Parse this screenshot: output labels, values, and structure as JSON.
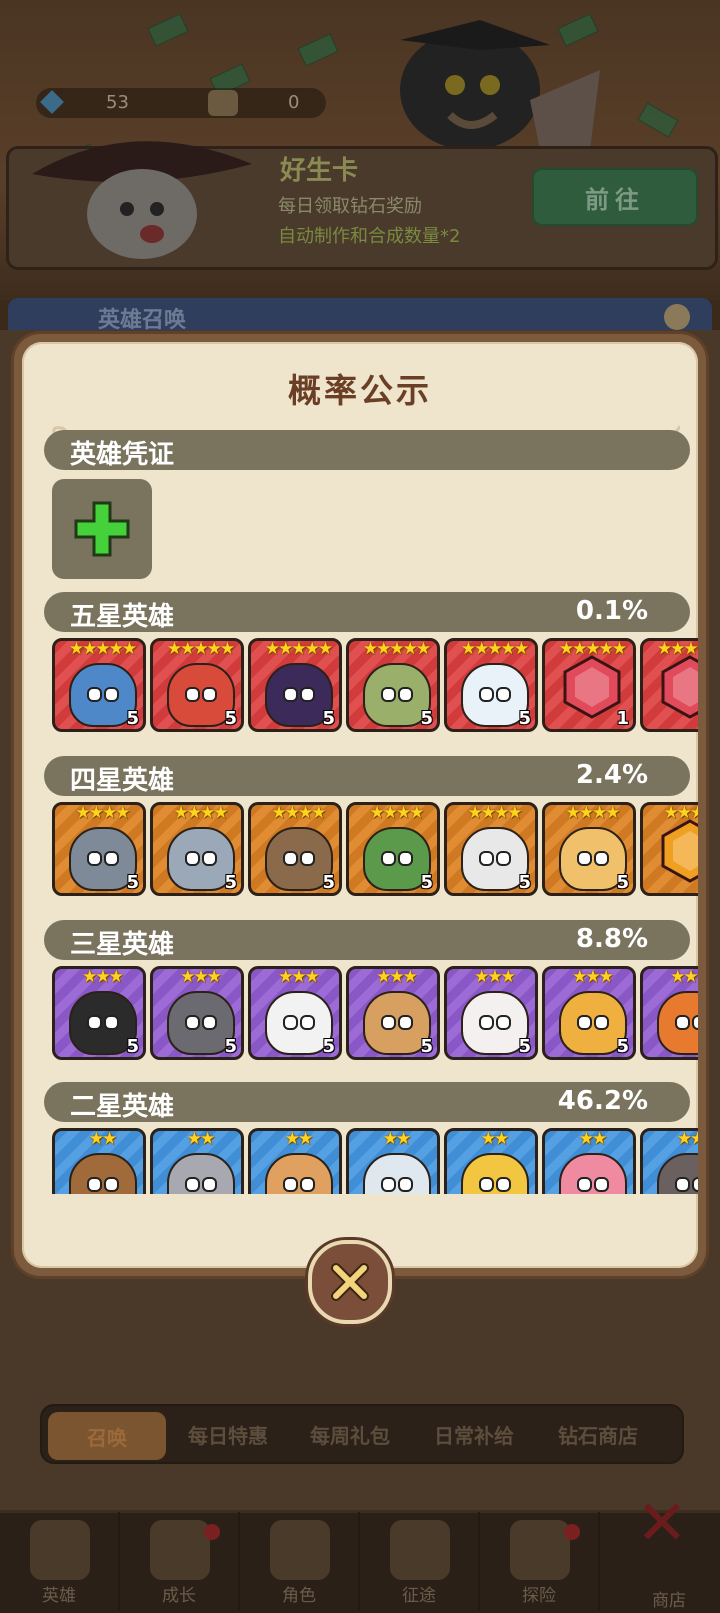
{
  "background": {
    "resources": {
      "gems": "53",
      "other": "0"
    },
    "banner": {
      "title": "好生卡",
      "line1": "每日领取钻石奖励",
      "line2": "自动制作和合成数量*2",
      "go_button": "前往"
    },
    "summon_strip_label": "英雄召唤",
    "tabs": [
      "召唤",
      "每日特惠",
      "每周礼包",
      "日常补给",
      "钻石商店"
    ],
    "active_tab": "召唤",
    "nav": [
      "英雄",
      "成长",
      "角色",
      "征途",
      "探险"
    ],
    "nav_shop_label": "商店"
  },
  "modal": {
    "title": "概率公示",
    "voucher_section": "英雄凭证",
    "sections": [
      {
        "label": "五星英雄",
        "percent": "0.1%",
        "rarity": "r5",
        "stars": "★★★★★",
        "cards": [
          {
            "icon": "shark-pirate-icon",
            "count": "5",
            "color": "#4e88c8"
          },
          {
            "icon": "red-warrior-icon",
            "count": "5",
            "color": "#d84a3a"
          },
          {
            "icon": "dark-reaper-icon",
            "count": "5",
            "color": "#3b2a5a"
          },
          {
            "icon": "crocodile-king-icon",
            "count": "5",
            "color": "#9ab06a"
          },
          {
            "icon": "polar-bear-icon",
            "count": "5",
            "color": "#e8f2f8"
          },
          {
            "icon": "red-hexagon-gem-icon",
            "count": "1",
            "color": "#e04a5a"
          },
          {
            "icon": "red-hexagon-gem-icon",
            "count": "",
            "color": "#e04a5a"
          }
        ]
      },
      {
        "label": "四星英雄",
        "percent": "2.4%",
        "rarity": "r4",
        "stars": "★★★★",
        "cards": [
          {
            "icon": "shark-icon",
            "count": "5",
            "color": "#7e8a98"
          },
          {
            "icon": "knight-rhino-icon",
            "count": "5",
            "color": "#9aa8b8"
          },
          {
            "icon": "owl-icon",
            "count": "5",
            "color": "#8a6a4a"
          },
          {
            "icon": "pirate-crocodile-icon",
            "count": "5",
            "color": "#5a9a4a"
          },
          {
            "icon": "raccoon-icon",
            "count": "5",
            "color": "#e8e8e8"
          },
          {
            "icon": "leopard-icon",
            "count": "5",
            "color": "#f0c06a"
          },
          {
            "icon": "orange-hexagon-gem-icon",
            "count": "",
            "color": "#f0a020"
          }
        ]
      },
      {
        "label": "三星英雄",
        "percent": "8.8%",
        "rarity": "r3",
        "stars": "★★★",
        "cards": [
          {
            "icon": "penguin-icon",
            "count": "5",
            "color": "#2b2b2b"
          },
          {
            "icon": "viking-wolf-icon",
            "count": "5",
            "color": "#6a6a70"
          },
          {
            "icon": "fox-witch-icon",
            "count": "5",
            "color": "#f2f2f2"
          },
          {
            "icon": "rabbit-pilot-icon",
            "count": "5",
            "color": "#d8a060"
          },
          {
            "icon": "white-rabbit-icon",
            "count": "5",
            "color": "#f4f0f0"
          },
          {
            "icon": "blonde-fox-icon",
            "count": "5",
            "color": "#f0b040"
          },
          {
            "icon": "orange-fox-icon",
            "count": "",
            "color": "#e87a30"
          }
        ]
      },
      {
        "label": "二星英雄",
        "percent": "46.2%",
        "rarity": "r2",
        "stars": "★★",
        "cards": [
          {
            "icon": "horse-icon",
            "count": "",
            "color": "#a06a3a"
          },
          {
            "icon": "koala-icon",
            "count": "",
            "color": "#a8a8b0"
          },
          {
            "icon": "hamster-icon",
            "count": "",
            "color": "#e0a060"
          },
          {
            "icon": "seal-icon",
            "count": "",
            "color": "#dfe8ef"
          },
          {
            "icon": "duck-icon",
            "count": "",
            "color": "#f2c640"
          },
          {
            "icon": "axolotl-icon",
            "count": "",
            "color": "#f08aa0"
          },
          {
            "icon": "wolf-icon",
            "count": "",
            "color": "#6a6060"
          }
        ]
      }
    ]
  },
  "colors": {
    "panel": "#efe5cd",
    "section_bar": "#7a745f",
    "title": "#6a3f26",
    "plus": "#45d13a"
  }
}
